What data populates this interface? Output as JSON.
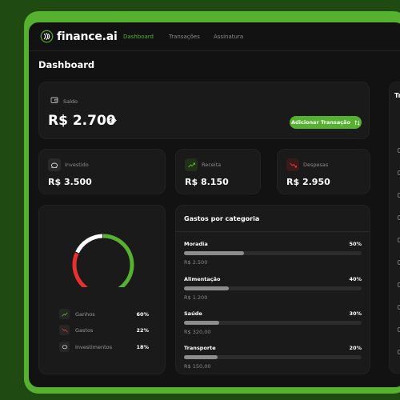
{
  "app": {
    "name": "finance.ai",
    "nav": [
      {
        "label": "Dashboard",
        "active": true
      },
      {
        "label": "Transações",
        "active": false
      },
      {
        "label": "Assinatura",
        "active": false
      }
    ]
  },
  "page_title": "Dashboard",
  "balance": {
    "label": "Saldo",
    "amount": "R$ 2.700",
    "add_button_label": "Adicionar Transação",
    "visibility_icon": "eye-icon"
  },
  "stats": [
    {
      "label": "Investido",
      "value": "R$ 3.500",
      "icon": "piggy-bank-icon"
    },
    {
      "label": "Receita",
      "value": "R$ 8.150",
      "icon": "trending-up-icon",
      "color": "#55b12f"
    },
    {
      "label": "Despesas",
      "value": "R$ 2.950",
      "icon": "trending-down-icon",
      "color": "#e93030"
    }
  ],
  "donut": {
    "slices": [
      {
        "label": "Ganhos",
        "percent": "60%",
        "value": 60,
        "color": "#55b12f",
        "icon": "trending-up-icon"
      },
      {
        "label": "Gastos",
        "percent": "22%",
        "value": 22,
        "color": "#e93030",
        "icon": "trending-down-icon"
      },
      {
        "label": "Investimentos",
        "percent": "18%",
        "value": 18,
        "color": "#ffffff",
        "icon": "piggy-bank-icon"
      }
    ]
  },
  "categories": {
    "title": "Gastos por categoria",
    "items": [
      {
        "name": "Moradia",
        "percent": "50%",
        "fraction": 0.34,
        "amount": "R$ 2.500"
      },
      {
        "name": "Alimentação",
        "percent": "40%",
        "fraction": 0.25,
        "amount": "R$ 1.200"
      },
      {
        "name": "Saúde",
        "percent": "30%",
        "fraction": 0.2,
        "amount": "R$ 320,00"
      },
      {
        "name": "Transporte",
        "percent": "20%",
        "fraction": 0.19,
        "amount": "R$ 150,00"
      }
    ]
  },
  "transactions": {
    "title": "Tr"
  },
  "colors": {
    "accent": "#55b12f",
    "danger": "#e93030",
    "background": "#121212",
    "card": "#1a1a1a"
  }
}
